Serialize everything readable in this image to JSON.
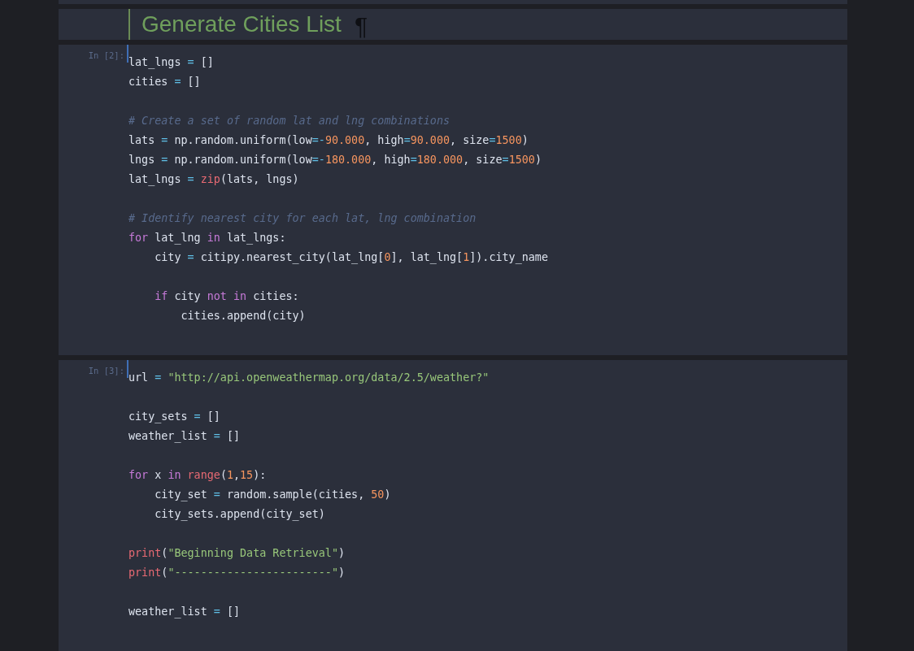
{
  "cells": [
    {
      "kind": "markdown",
      "heading": "Generate Cities List",
      "anchor": "¶"
    },
    {
      "kind": "code",
      "prompt": "In [2]:",
      "lines": [
        {
          "kind": "code",
          "tokens": [
            {
              "t": "lat_lngs",
              "kind": "name"
            },
            {
              "t": " = ",
              "kind": "op"
            },
            {
              "t": "[]",
              "kind": "name"
            }
          ]
        },
        {
          "kind": "code",
          "tokens": [
            {
              "t": "cities",
              "kind": "name"
            },
            {
              "t": " = ",
              "kind": "op"
            },
            {
              "t": "[]",
              "kind": "name"
            }
          ]
        },
        {
          "kind": "blank"
        },
        {
          "kind": "code",
          "tokens": [
            {
              "t": "# Create a set of random lat and lng combinations",
              "kind": "comment"
            }
          ]
        },
        {
          "kind": "code",
          "tokens": [
            {
              "t": "lats",
              "kind": "name"
            },
            {
              "t": " = ",
              "kind": "op"
            },
            {
              "t": "np.random.uniform(low",
              "kind": "name"
            },
            {
              "t": "=-",
              "kind": "op"
            },
            {
              "t": "90.000",
              "kind": "num"
            },
            {
              "t": ", high",
              "kind": "name"
            },
            {
              "t": "=",
              "kind": "op"
            },
            {
              "t": "90.000",
              "kind": "num"
            },
            {
              "t": ", size",
              "kind": "name"
            },
            {
              "t": "=",
              "kind": "op"
            },
            {
              "t": "1500",
              "kind": "num"
            },
            {
              "t": ")",
              "kind": "name"
            }
          ]
        },
        {
          "kind": "code",
          "tokens": [
            {
              "t": "lngs",
              "kind": "name"
            },
            {
              "t": " = ",
              "kind": "op"
            },
            {
              "t": "np.random.uniform(low",
              "kind": "name"
            },
            {
              "t": "=-",
              "kind": "op"
            },
            {
              "t": "180.000",
              "kind": "num"
            },
            {
              "t": ", high",
              "kind": "name"
            },
            {
              "t": "=",
              "kind": "op"
            },
            {
              "t": "180.000",
              "kind": "num"
            },
            {
              "t": ", size",
              "kind": "name"
            },
            {
              "t": "=",
              "kind": "op"
            },
            {
              "t": "1500",
              "kind": "num"
            },
            {
              "t": ")",
              "kind": "name"
            }
          ]
        },
        {
          "kind": "code",
          "tokens": [
            {
              "t": "lat_lngs",
              "kind": "name"
            },
            {
              "t": " = ",
              "kind": "op"
            },
            {
              "t": "zip",
              "kind": "builtin"
            },
            {
              "t": "(lats, lngs)",
              "kind": "name"
            }
          ]
        },
        {
          "kind": "blank"
        },
        {
          "kind": "code",
          "tokens": [
            {
              "t": "# Identify nearest city for each lat, lng combination",
              "kind": "comment"
            }
          ]
        },
        {
          "kind": "code",
          "tokens": [
            {
              "t": "for",
              "kind": "kw"
            },
            {
              "t": " lat_lng ",
              "kind": "name"
            },
            {
              "t": "in",
              "kind": "kw"
            },
            {
              "t": " lat_lngs:",
              "kind": "name"
            }
          ],
          "children": [
            {
              "kind": "code",
              "tokens": [
                {
                  "t": "city",
                  "kind": "name"
                },
                {
                  "t": " = ",
                  "kind": "op"
                },
                {
                  "t": "citipy.nearest_city(lat_lng[",
                  "kind": "name"
                },
                {
                  "t": "0",
                  "kind": "num"
                },
                {
                  "t": "], lat_lng[",
                  "kind": "name"
                },
                {
                  "t": "1",
                  "kind": "num"
                },
                {
                  "t": "]).city_name",
                  "kind": "name"
                }
              ]
            },
            {
              "kind": "blank"
            },
            {
              "kind": "code",
              "tokens": [
                {
                  "t": "if",
                  "kind": "kw"
                },
                {
                  "t": " city ",
                  "kind": "name"
                },
                {
                  "t": "not ",
                  "kind": "kw"
                },
                {
                  "t": "in",
                  "kind": "kw"
                },
                {
                  "t": " cities:",
                  "kind": "name"
                }
              ],
              "children": [
                {
                  "kind": "code",
                  "tokens": [
                    {
                      "t": "cities.append(city)",
                      "kind": "name"
                    }
                  ]
                }
              ]
            }
          ]
        }
      ]
    },
    {
      "kind": "code",
      "prompt": "In [3]:",
      "lines": [
        {
          "kind": "code",
          "tokens": [
            {
              "t": "url",
              "kind": "name"
            },
            {
              "t": " = ",
              "kind": "op"
            },
            {
              "t": "\"http://api.openweathermap.org/data/2.5/weather?\"",
              "kind": "str"
            }
          ]
        },
        {
          "kind": "blank"
        },
        {
          "kind": "code",
          "tokens": [
            {
              "t": "city_sets",
              "kind": "name"
            },
            {
              "t": " = ",
              "kind": "op"
            },
            {
              "t": "[]",
              "kind": "name"
            }
          ]
        },
        {
          "kind": "code",
          "tokens": [
            {
              "t": "weather_list",
              "kind": "name"
            },
            {
              "t": " = ",
              "kind": "op"
            },
            {
              "t": "[]",
              "kind": "name"
            }
          ]
        },
        {
          "kind": "blank"
        },
        {
          "kind": "code",
          "tokens": [
            {
              "t": "for",
              "kind": "kw"
            },
            {
              "t": " x ",
              "kind": "name"
            },
            {
              "t": "in ",
              "kind": "kw"
            },
            {
              "t": "range",
              "kind": "builtin"
            },
            {
              "t": "(",
              "kind": "name"
            },
            {
              "t": "1",
              "kind": "num"
            },
            {
              "t": ",",
              "kind": "name"
            },
            {
              "t": "15",
              "kind": "num"
            },
            {
              "t": "):",
              "kind": "name"
            }
          ],
          "children": [
            {
              "kind": "code",
              "tokens": [
                {
                  "t": "city_set",
                  "kind": "name"
                },
                {
                  "t": " = ",
                  "kind": "op"
                },
                {
                  "t": "random.sample(cities, ",
                  "kind": "name"
                },
                {
                  "t": "50",
                  "kind": "num"
                },
                {
                  "t": ")",
                  "kind": "name"
                }
              ]
            },
            {
              "kind": "code",
              "tokens": [
                {
                  "t": "city_sets.append(city_set)",
                  "kind": "name"
                }
              ]
            }
          ]
        },
        {
          "kind": "blank"
        },
        {
          "kind": "code",
          "tokens": [
            {
              "t": "print",
              "kind": "builtin"
            },
            {
              "t": "(",
              "kind": "name"
            },
            {
              "t": "\"Beginning Data Retrieval\"",
              "kind": "str"
            },
            {
              "t": ")",
              "kind": "name"
            }
          ]
        },
        {
          "kind": "code",
          "tokens": [
            {
              "t": "print",
              "kind": "builtin"
            },
            {
              "t": "(",
              "kind": "name"
            },
            {
              "t": "\"------------------------\"",
              "kind": "str"
            },
            {
              "t": ")",
              "kind": "name"
            }
          ]
        },
        {
          "kind": "blank"
        },
        {
          "kind": "code",
          "tokens": [
            {
              "t": "weather_list",
              "kind": "name"
            },
            {
              "t": " = ",
              "kind": "op"
            },
            {
              "t": "[]",
              "kind": "name"
            }
          ]
        }
      ]
    }
  ]
}
